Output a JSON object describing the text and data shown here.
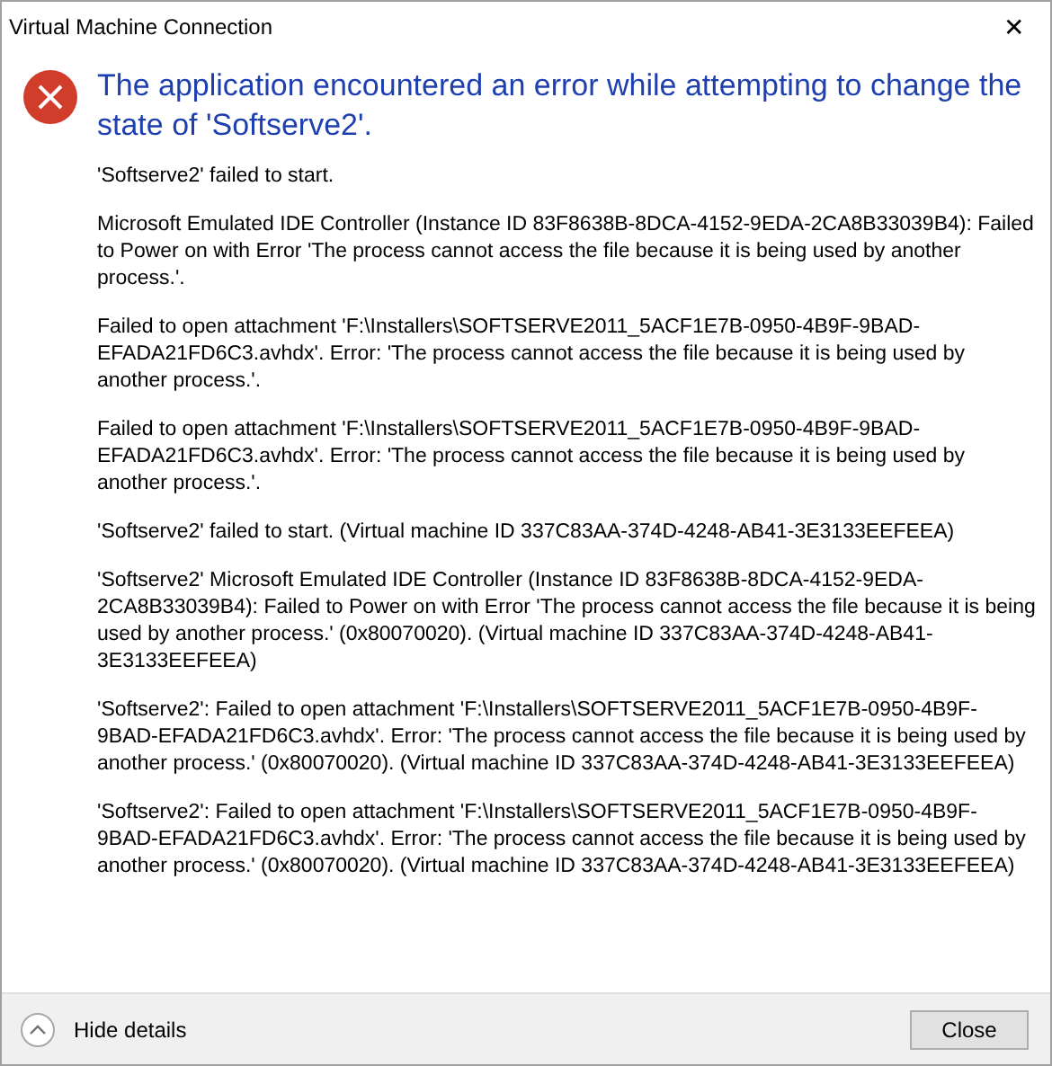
{
  "window": {
    "title": "Virtual Machine Connection",
    "close_glyph": "✕"
  },
  "heading": "The application encountered an error while attempting to change the state of 'Softserve2'.",
  "details": [
    "'Softserve2' failed to start.",
    "Microsoft Emulated IDE Controller (Instance ID 83F8638B-8DCA-4152-9EDA-2CA8B33039B4): Failed to Power on with Error 'The process cannot access the file because it is being used by another process.'.",
    "Failed to open attachment 'F:\\Installers\\SOFTSERVE2011_5ACF1E7B-0950-4B9F-9BAD-EFADA21FD6C3.avhdx'. Error: 'The process cannot access the file because it is being used by another process.'.",
    "Failed to open attachment 'F:\\Installers\\SOFTSERVE2011_5ACF1E7B-0950-4B9F-9BAD-EFADA21FD6C3.avhdx'. Error: 'The process cannot access the file because it is being used by another process.'.",
    "'Softserve2' failed to start. (Virtual machine ID 337C83AA-374D-4248-AB41-3E3133EEFEEA)",
    "'Softserve2' Microsoft Emulated IDE Controller (Instance ID 83F8638B-8DCA-4152-9EDA-2CA8B33039B4): Failed to Power on with Error 'The process cannot access the file because it is being used by another process.' (0x80070020). (Virtual machine ID 337C83AA-374D-4248-AB41-3E3133EEFEEA)",
    "'Softserve2': Failed to open attachment 'F:\\Installers\\SOFTSERVE2011_5ACF1E7B-0950-4B9F-9BAD-EFADA21FD6C3.avhdx'. Error: 'The process cannot access the file because it is being used by another process.' (0x80070020). (Virtual machine ID 337C83AA-374D-4248-AB41-3E3133EEFEEA)",
    "'Softserve2': Failed to open attachment 'F:\\Installers\\SOFTSERVE2011_5ACF1E7B-0950-4B9F-9BAD-EFADA21FD6C3.avhdx'. Error: 'The process cannot access the file because it is being used by another process.' (0x80070020). (Virtual machine ID 337C83AA-374D-4248-AB41-3E3133EEFEEA)"
  ],
  "footer": {
    "details_toggle": "Hide details",
    "details_expanded": true,
    "close_button": "Close"
  }
}
